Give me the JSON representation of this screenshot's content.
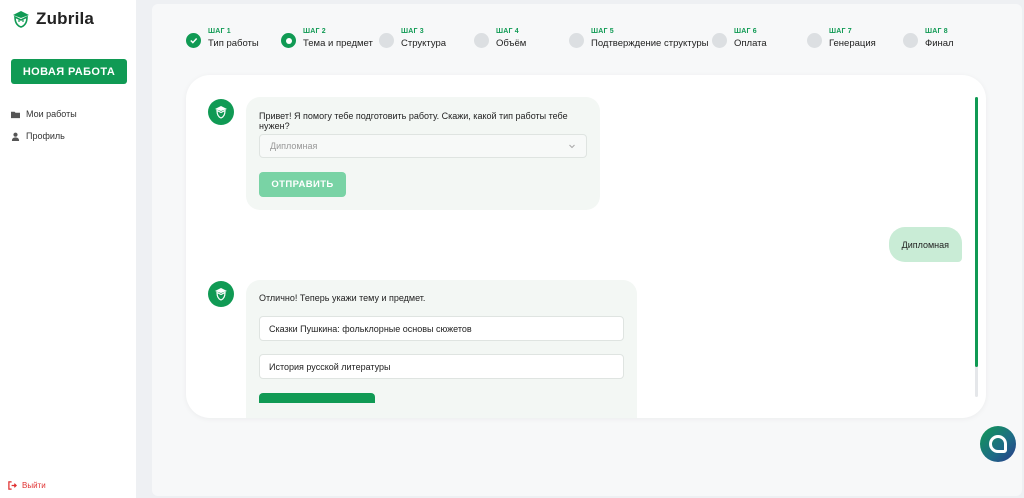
{
  "sidebar": {
    "logo_text": "Zubrila",
    "new_work_label": "НОВАЯ РАБОТА",
    "nav": [
      {
        "label": "Мои работы",
        "icon": "folder-icon"
      },
      {
        "label": "Профиль",
        "icon": "user-icon"
      }
    ],
    "logout_label": "Выйти"
  },
  "steps": [
    {
      "label": "ШАГ 1",
      "name": "Тип работы",
      "state": "done"
    },
    {
      "label": "ШАГ 2",
      "name": "Тема и предмет",
      "state": "active"
    },
    {
      "label": "ШАГ 3",
      "name": "Структура",
      "state": "pending"
    },
    {
      "label": "ШАГ 4",
      "name": "Объём",
      "state": "pending"
    },
    {
      "label": "ШАГ 5",
      "name": "Подтверждение структуры",
      "state": "pending"
    },
    {
      "label": "ШАГ 6",
      "name": "Оплата",
      "state": "pending"
    },
    {
      "label": "ШАГ 7",
      "name": "Генерация",
      "state": "pending"
    },
    {
      "label": "ШАГ 8",
      "name": "Финал",
      "state": "pending"
    }
  ],
  "chat": {
    "msg1": {
      "text": "Привет! Я помогу тебе подготовить работу. Скажи, какой тип работы тебе нужен?",
      "select_value": "Дипломная",
      "send_label": "ОТПРАВИТЬ"
    },
    "user_reply": "Дипломная",
    "msg2": {
      "text": "Отлично! Теперь укажи тему и предмет.",
      "topic_value": "Сказки Пушкина: фольклорные основы сюжетов",
      "subject_value": "История русской литературы"
    }
  },
  "colors": {
    "accent": "#109a54",
    "accent_light": "#79d3a5",
    "user_bubble": "#c9ecd6",
    "danger": "#e03131"
  }
}
